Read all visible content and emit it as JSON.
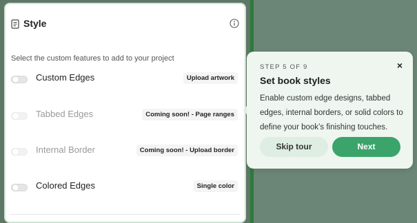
{
  "panel": {
    "title": "Style",
    "icon": "document-icon",
    "info_icon": "info-icon",
    "subtitle": "Select the custom features to add to your project",
    "features": [
      {
        "label": "Custom Edges",
        "tag": "Upload artwork",
        "enabled": true,
        "on": false
      },
      {
        "label": "Tabbed Edges",
        "tag": "Coming soon! - Page ranges",
        "enabled": false,
        "on": false
      },
      {
        "label": "Internal Border",
        "tag": "Coming soon! - Upload border",
        "enabled": false,
        "on": false
      },
      {
        "label": "Colored Edges",
        "tag": "Single color",
        "enabled": true,
        "on": false
      }
    ]
  },
  "tour": {
    "step": "STEP 5 OF 9",
    "close_icon": "close-icon",
    "close_glyph": "×",
    "title": "Set book styles",
    "body": "Enable custom edge designs, tabbed edges, internal borders, or solid colors to define your book’s finishing touches.",
    "skip_label": "Skip tour",
    "next_label": "Next"
  },
  "colors": {
    "overlay": "#5f7767",
    "accent": "#3aa46a",
    "card_bg": "#eef6ef",
    "panel_border": "#cfe5d3"
  }
}
